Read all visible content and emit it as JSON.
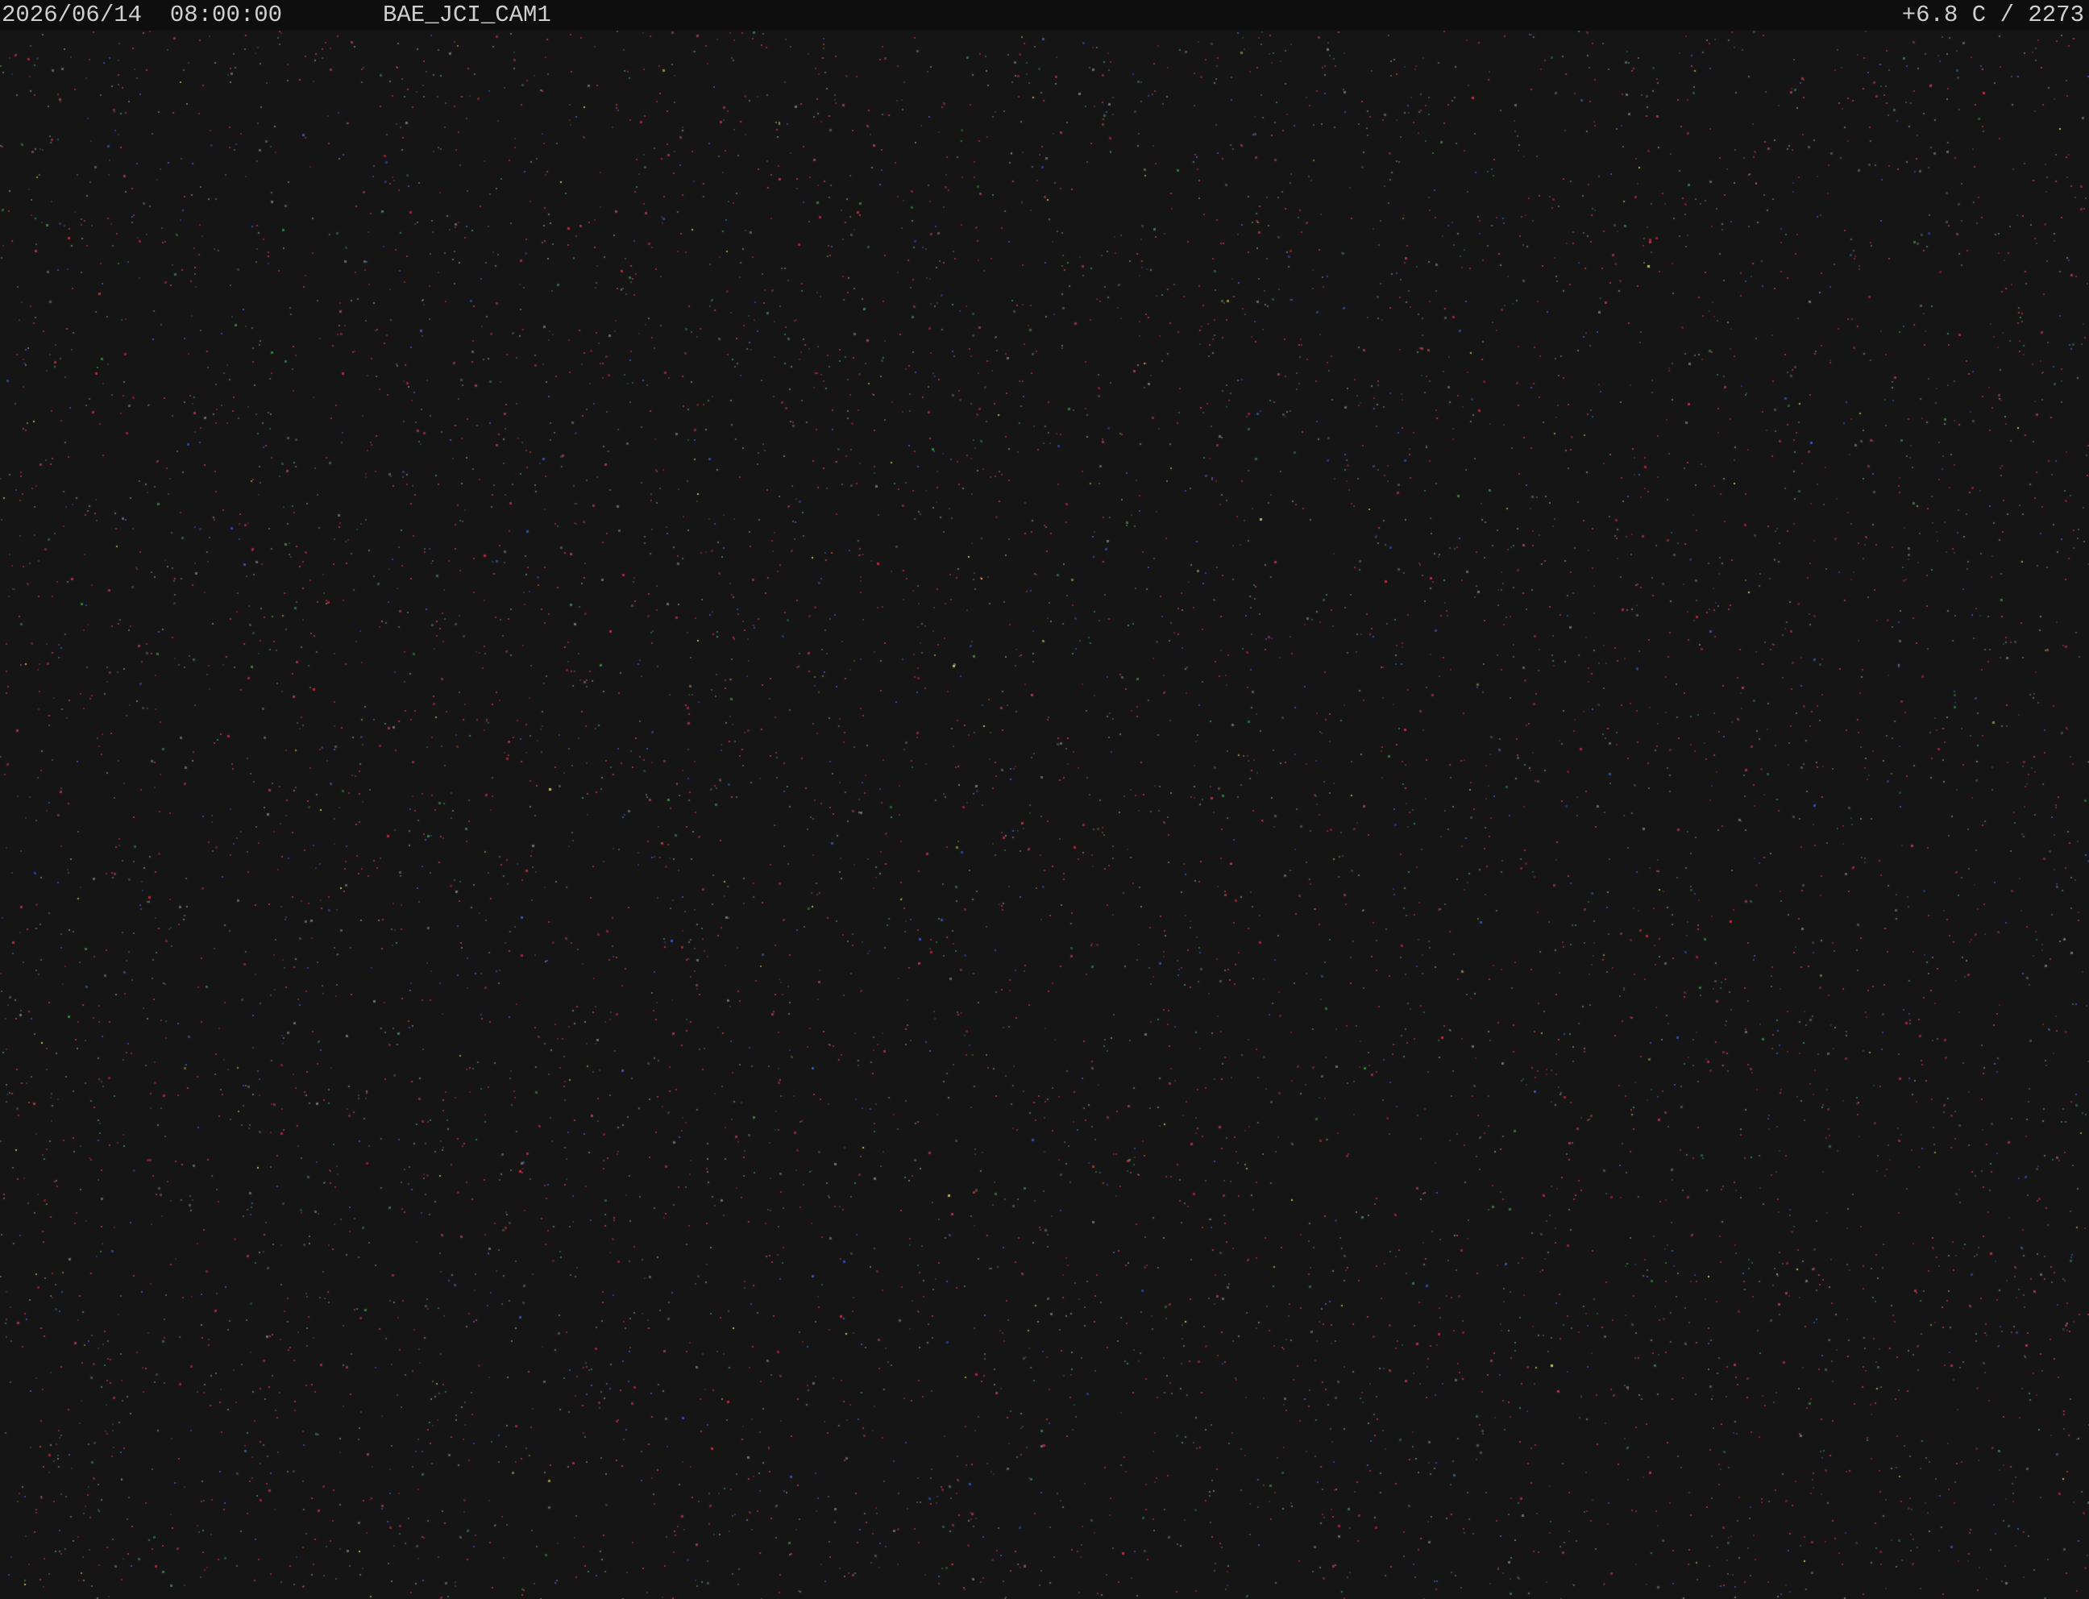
{
  "overlay": {
    "datetime": "2026/06/14  08:00:00",
    "camera_id": "BAE_JCI_CAM1",
    "readout": "+6.8 C / 2273"
  },
  "image": {
    "content": "dark sensor noise",
    "background_color": "#151515",
    "header_bar_color": "#0e0e0e",
    "text_color": "#cfcfcf",
    "noise_colors": [
      "#c2334a",
      "#3a5ac8",
      "#3c8a4a",
      "#7a7a7a",
      "#e0d060"
    ]
  }
}
